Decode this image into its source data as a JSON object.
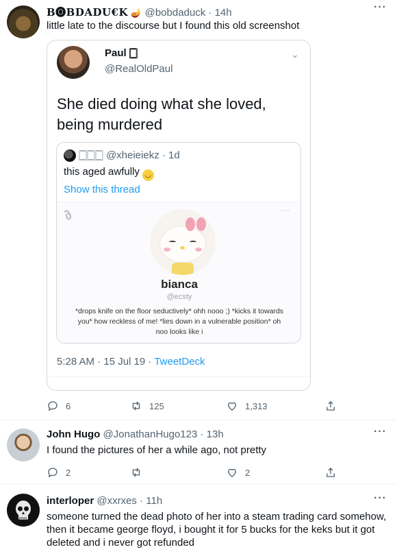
{
  "tweets": [
    {
      "name": "B🅞BDADU€K",
      "emoji_after_name": "🪔",
      "handle": "@bobdaduck · 14h",
      "text": "little late to the discourse but I found this old screenshot",
      "embedded": {
        "name": "Paul 🀆",
        "handle": "@RealOldPaul",
        "text": "She died doing what she loved, being murdered",
        "quote": {
          "handle": "🀆🀆🀆 @xheieiekz · 1d",
          "text": "this aged awfully",
          "show_thread": "Show this thread",
          "profile": {
            "name": "bianca",
            "handle": "@ecsty",
            "bio": "*drops knife on the floor seductively* ohh nooo ;) *kicks it towards you* how reckless of me! *lies down in a vulnerable position* oh noo looks like i"
          }
        },
        "timestamp": "5:28 AM · 15 Jul 19 · ",
        "source": "TweetDeck"
      },
      "replies": "6",
      "retweets": "125",
      "likes": "1,313"
    },
    {
      "name": "John Hugo",
      "handle": "@JonathanHugo123 · 13h",
      "text": "I found the pictures of her a while ago, not pretty",
      "replies": "2",
      "retweets": "",
      "likes": "2"
    },
    {
      "name": "interloper",
      "handle": "@xxrxes · 11h",
      "text": "someone turned the dead photo of her into a steam trading card somehow, then it became george floyd, i bought it for 5 bucks for the keks but it got deleted and i never got refunded"
    }
  ],
  "more_glyph": "···",
  "chevron_glyph": "⌄",
  "icons": {
    "reply": "reply-icon",
    "retweet": "retweet-icon",
    "like": "heart-icon",
    "share": "share-icon"
  },
  "colors": {
    "link": "#1d9bf0",
    "secondary": "#536471",
    "border": "#cfd9de"
  }
}
